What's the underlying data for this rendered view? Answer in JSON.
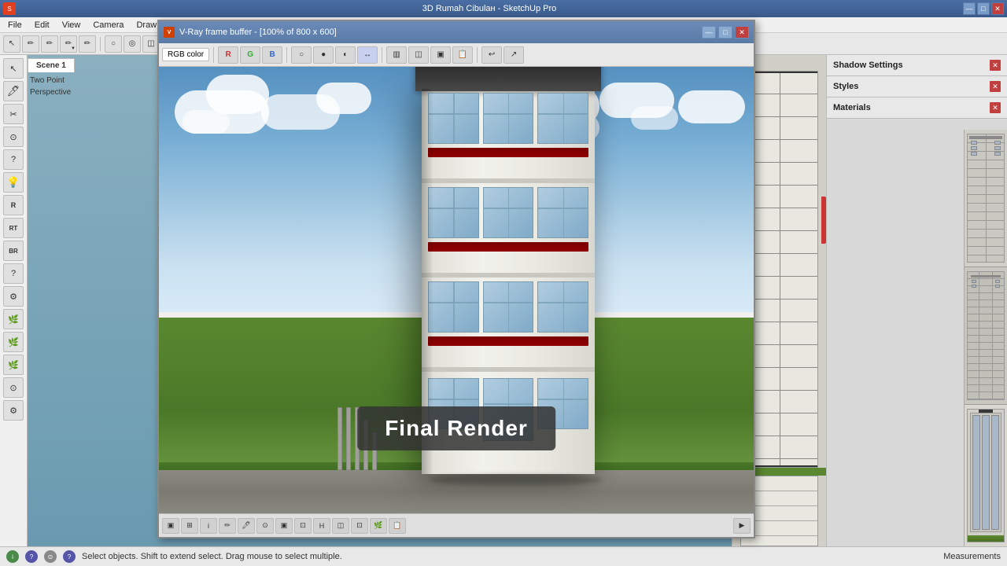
{
  "titleBar": {
    "title": "3D Rumah Cibulан - SketchUp Pro",
    "minimize": "—",
    "maximize": "□",
    "close": "✕"
  },
  "menuBar": {
    "items": [
      "File",
      "Edit",
      "View",
      "Camera",
      "Draw"
    ]
  },
  "toolbar": {
    "buttons": [
      "↖",
      "✏",
      "✏",
      "✏",
      "✏",
      "○",
      "●",
      "◫",
      "↗",
      "⊙",
      "◐",
      "▣",
      "⊞",
      "↩",
      "↪",
      "🎨",
      "▣",
      "□",
      "⊡"
    ]
  },
  "leftSidebar": {
    "tools": [
      "↖",
      "✏",
      "🖊",
      "✂",
      "⊙",
      "?",
      "💡",
      "R",
      "RT",
      "BR",
      "?",
      "🔧",
      "🌿",
      "🌿",
      "🌿",
      "⊙",
      "⚙"
    ]
  },
  "sceneTabs": {
    "tabs": [
      "Scene 1"
    ],
    "activeTab": "Scene 1"
  },
  "sceneInfo": {
    "projection": "Two Point",
    "view": "Perspective"
  },
  "vrayWindow": {
    "title": "V-Ray frame buffer - [100% of 800 x 600]",
    "minimize": "—",
    "maximize": "□",
    "close": "✕"
  },
  "vrayToolbar": {
    "colorMode": "RGB color",
    "buttons": [
      "R",
      "G",
      "B",
      "○",
      "●",
      "◫",
      "⊡",
      "↔",
      "◐",
      "▣",
      "⊞",
      "📋",
      "↩",
      "↪"
    ]
  },
  "renderImage": {
    "label": "Final Render"
  },
  "vrayBottomBar": {
    "buttons": [
      "▣",
      "⊞",
      "i",
      "✏",
      "🖊",
      "⊙",
      "▣",
      "⊡",
      "H",
      "◫",
      "⊡",
      "🌿",
      "📋"
    ]
  },
  "rightPanel": {
    "sections": [
      {
        "label": "Shadow Settings",
        "key": "shadow-settings"
      },
      {
        "label": "Styles",
        "key": "styles"
      },
      {
        "label": "Materials",
        "key": "materials"
      }
    ]
  },
  "statusBar": {
    "message": "Select objects. Shift to extend select. Drag mouse to select multiple.",
    "right": "Measurements",
    "icons": [
      "i",
      "?",
      "⊙",
      "?"
    ]
  }
}
